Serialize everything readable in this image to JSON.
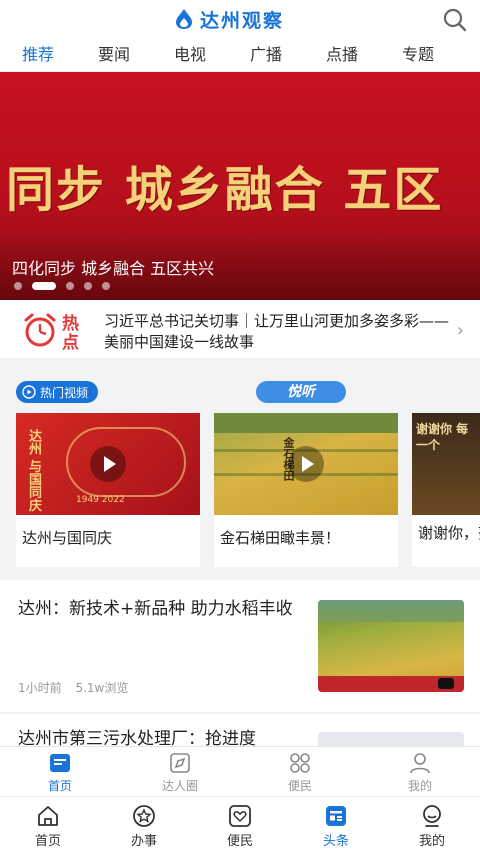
{
  "app": {
    "logo_text": "达州观察",
    "brand_color": "#1a73d9"
  },
  "header": {
    "search_icon": "search-icon"
  },
  "tabs": [
    {
      "label": "推荐",
      "active": true
    },
    {
      "label": "要闻"
    },
    {
      "label": "电视"
    },
    {
      "label": "广播"
    },
    {
      "label": "点播"
    },
    {
      "label": "专题"
    }
  ],
  "banner": {
    "image_text": "同步 城乡融合 五区",
    "caption": "四化同步 城乡融合 五区共兴",
    "slide_count": 5,
    "active_slide": 2
  },
  "hot": {
    "badge": "热点",
    "headline": "习近平总书记关切事｜让万里山河更加多姿多彩——美丽中国建设一线故事"
  },
  "videos": {
    "hot_label": "热门视频",
    "yue_label": "悦听",
    "items": [
      {
        "title": "达州与国同庆",
        "thumb_text": "达州 与国同庆",
        "thumb_years": "1949 2022"
      },
      {
        "title": "金石梯田瞰丰景！",
        "thumb_text": "金石梯田"
      },
      {
        "title": "谢谢你，努力的人",
        "thumb_text": "谢谢你 每一个"
      }
    ]
  },
  "articles": [
    {
      "title": "达州：新技术+新品种 助力水稻丰收",
      "time": "1小时前",
      "views": "5.1w浏览"
    },
    {
      "title": "达州市第三污水处理厂：抢进度"
    }
  ],
  "inner_nav": [
    {
      "label": "首页",
      "icon": "home-icon",
      "active": true
    },
    {
      "label": "达人圈",
      "icon": "compass-icon"
    },
    {
      "label": "便民",
      "icon": "grid-icon"
    },
    {
      "label": "我的",
      "icon": "user-icon"
    }
  ],
  "bottom_nav": [
    {
      "label": "首页",
      "icon": "home-icon"
    },
    {
      "label": "办事",
      "icon": "star-icon"
    },
    {
      "label": "便民",
      "icon": "heart-icon"
    },
    {
      "label": "头条",
      "icon": "news-icon",
      "active": true
    },
    {
      "label": "我的",
      "icon": "face-icon"
    }
  ]
}
